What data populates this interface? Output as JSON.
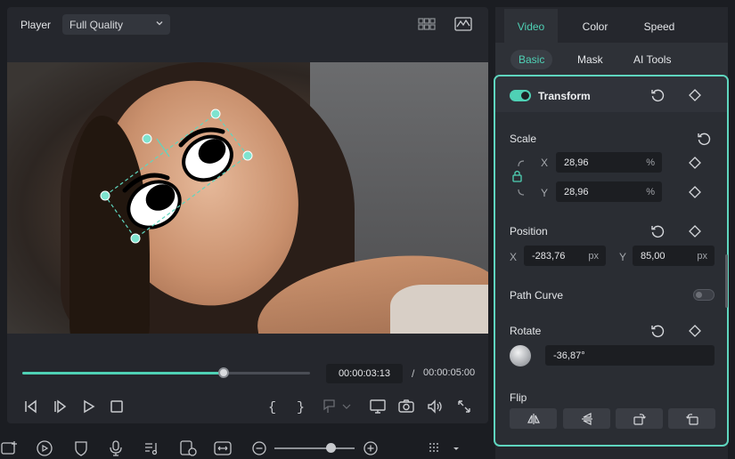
{
  "player": {
    "label": "Player",
    "quality": "Full Quality",
    "timecode": "00:00:03:13",
    "separator": "/",
    "duration": "00:00:05:00",
    "progress": 0.7
  },
  "tabs": [
    {
      "label": "Video",
      "active": true
    },
    {
      "label": "Color",
      "active": false
    },
    {
      "label": "Speed",
      "active": false
    }
  ],
  "subtabs": [
    {
      "label": "Basic",
      "active": true
    },
    {
      "label": "Mask",
      "active": false
    },
    {
      "label": "AI Tools",
      "active": false
    }
  ],
  "transform": {
    "title": "Transform",
    "enabled": true,
    "scale": {
      "label": "Scale",
      "x_axis": "X",
      "x_value": "28,96",
      "x_unit": "%",
      "y_axis": "Y",
      "y_value": "28,96",
      "y_unit": "%"
    },
    "position": {
      "label": "Position",
      "x_axis": "X",
      "x_value": "-283,76",
      "x_unit": "px",
      "y_axis": "Y",
      "y_value": "85,00",
      "y_unit": "px"
    },
    "path_curve": {
      "label": "Path Curve",
      "enabled": false
    },
    "rotate": {
      "label": "Rotate",
      "value": "-36,87°"
    },
    "flip": {
      "label": "Flip"
    }
  },
  "toolbar": {
    "zoom_level": 0.7,
    "icons": [
      "add-media-icon",
      "ai-icon",
      "shield-icon",
      "microphone-icon",
      "music-list-icon",
      "render-icon",
      "fit-icon",
      "zoom-out-icon",
      "zoom-in-icon"
    ]
  },
  "colors": {
    "accent": "#4fd1b5",
    "panel": "#25272d",
    "background": "#1b1d22"
  }
}
